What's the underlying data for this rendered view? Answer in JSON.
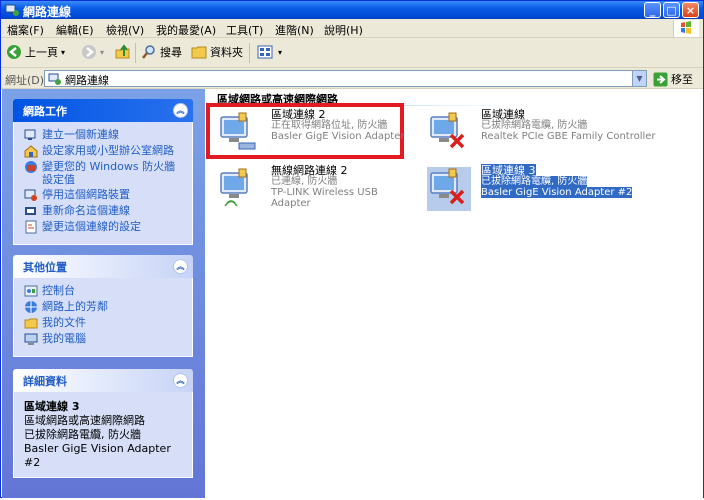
{
  "window": {
    "title": "網路連線",
    "buttons": {
      "minimize": "_",
      "maximize": "□",
      "close": "×"
    }
  },
  "menu": [
    "檔案(F)",
    "編輯(E)",
    "檢視(V)",
    "我的最愛(A)",
    "工具(T)",
    "進階(N)",
    "說明(H)"
  ],
  "toolbar": {
    "back": "上一頁",
    "search": "搜尋",
    "folders": "資料夾"
  },
  "address": {
    "label": "網址(D)",
    "value": "網路連線",
    "go": "移至"
  },
  "sidebar": {
    "network_tasks": {
      "title": "網路工作",
      "items": [
        "建立一個新連線",
        "設定家用或小型辦公室網路",
        "變更您的 Windows 防火牆設定值",
        "停用這個網路裝置",
        "重新命名這個連線",
        "變更這個連線的設定"
      ]
    },
    "other_places": {
      "title": "其他位置",
      "items": [
        "控制台",
        "網路上的芳鄰",
        "我的文件",
        "我的電腦"
      ]
    },
    "details": {
      "title": "詳細資料",
      "name": "區域連線 3",
      "lines": [
        "區域網路或高速網際網路",
        "已拔除網路電纜, 防火牆",
        "Basler GigE Vision Adapter #2"
      ]
    }
  },
  "main": {
    "group_title": "區域網路或高速網際網路",
    "connections": [
      {
        "name": "區域連線 2",
        "status": "正在取得網路位址, 防火牆",
        "device": "Basler GigE Vision Adapter"
      },
      {
        "name": "區域連線",
        "status": "已拔除網路電纜, 防火牆",
        "device": "Realtek PCIe GBE Family Controller"
      },
      {
        "name": "無線網路連線 2",
        "status": "已連線, 防火牆",
        "device": "TP-LINK Wireless USB Adapter"
      },
      {
        "name": "區域連線 3",
        "status": "已拔除網路電纜, 防火牆",
        "device": "Basler GigE Vision Adapter #2"
      }
    ]
  },
  "colors": {
    "title_blue": "#0054e3",
    "pane_blue": "#6f8ddd",
    "highlight_red": "#e21b22",
    "selection": "#316ac5"
  }
}
